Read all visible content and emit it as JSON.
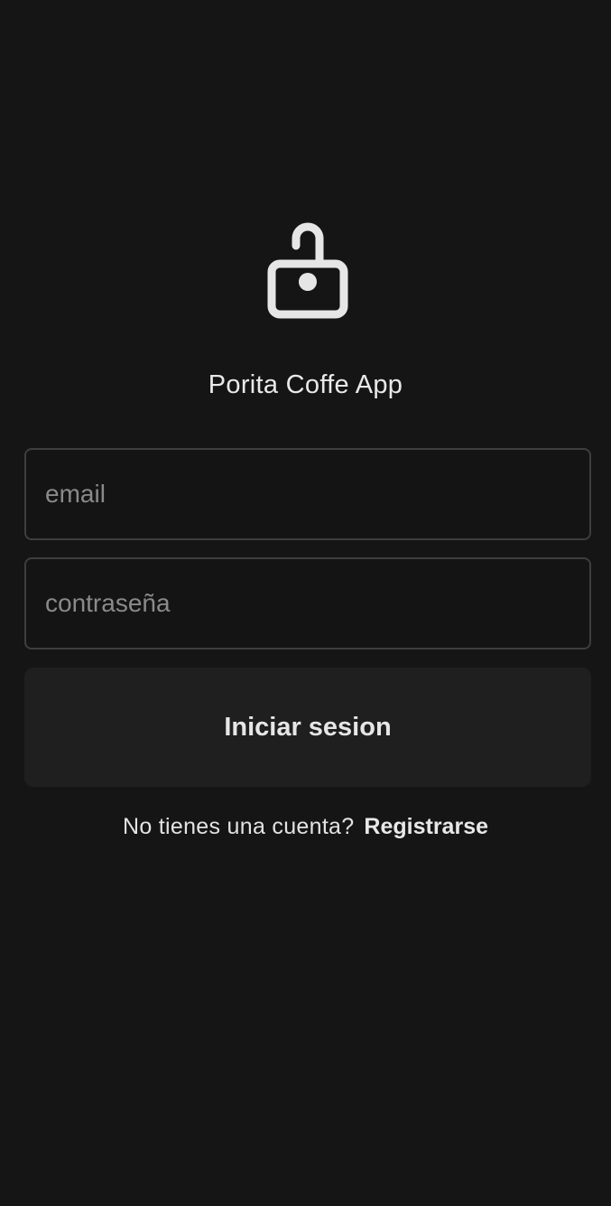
{
  "login": {
    "title": "Porita Coffe App",
    "icon": "lock-open-icon",
    "email_placeholder": "email",
    "password_placeholder": "contraseña",
    "submit_label": "Iniciar sesion",
    "register_prompt": "No tienes una cuenta?",
    "register_link": "Registrarse"
  },
  "colors": {
    "background": "#151515",
    "text": "#e9e9e9",
    "placeholder": "#8a8a8a",
    "field_border": "#3e3e3e",
    "button_bg": "#1f1f1f",
    "icon": "#e6e6e6"
  }
}
